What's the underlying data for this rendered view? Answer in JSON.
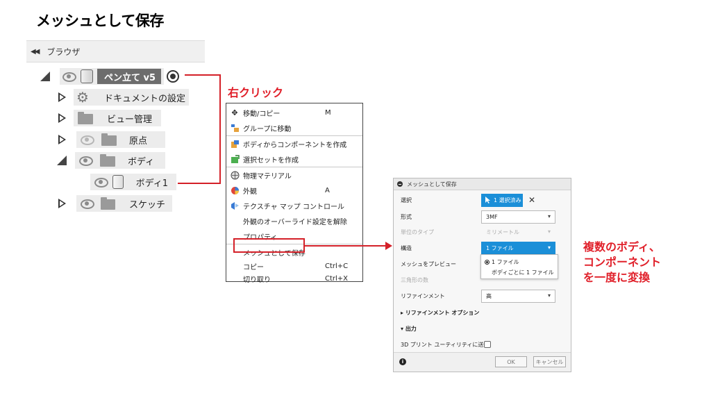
{
  "title": "メッシュとして保存",
  "browser": {
    "header": "ブラウザ",
    "collapse_glyph": "◀◀",
    "component": "ペン立て v5",
    "items": {
      "doc_settings": "ドキュメントの設定",
      "view_mgmt": "ビュー管理",
      "origin": "原点",
      "bodies": "ボディ",
      "body1": "ボディ1",
      "sketches": "スケッチ"
    }
  },
  "annotations": {
    "right_click": "右クリック",
    "note_line1": "複数のボディ、",
    "note_line2": "コンポーネント",
    "note_line3": "を一度に変換"
  },
  "context_menu": {
    "move_copy": "移動/コピー",
    "move_copy_shortcut": "M",
    "move_to_group": "グループに移動",
    "create_component_from_bodies": "ボディからコンポーネントを作成",
    "create_selection_set": "選択セットを作成",
    "physical_material": "物理マテリアル",
    "appearance": "外観",
    "appearance_shortcut": "A",
    "texture_map_control": "テクスチャ マップ コントロール",
    "remove_appearance_override": "外観のオーバーライド設定を解除",
    "properties": "プロパティ",
    "save_as_mesh": "メッシュとして保存",
    "copy": "コピー",
    "copy_shortcut": "Ctrl+C",
    "cut": "切り取り",
    "cut_shortcut": "Ctrl+X"
  },
  "dialog": {
    "title": "メッシュとして保存",
    "selection_label": "選択",
    "selection_value": "1 選択済み",
    "format_label": "形式",
    "format_value": "3MF",
    "unit_label": "単位のタイプ",
    "unit_value": "ミリメートル",
    "structure_label": "構造",
    "structure_value": "1 ファイル",
    "structure_options": [
      "1 ファイル",
      "ボディごとに 1 ファイル"
    ],
    "preview_label": "メッシュをプレビュー",
    "triangles_label": "三角形の数",
    "refinement_label": "リファインメント",
    "refinement_value": "高",
    "refinement_options_label": "リファインメント オプション",
    "output_label": "出力",
    "send_to_3d_label": "3D プリント ユーティリティに送信",
    "ok": "OK",
    "cancel": "キャンセル"
  },
  "colors": {
    "accent_red": "#d42028",
    "selection_blue": "#1b8fd8"
  }
}
